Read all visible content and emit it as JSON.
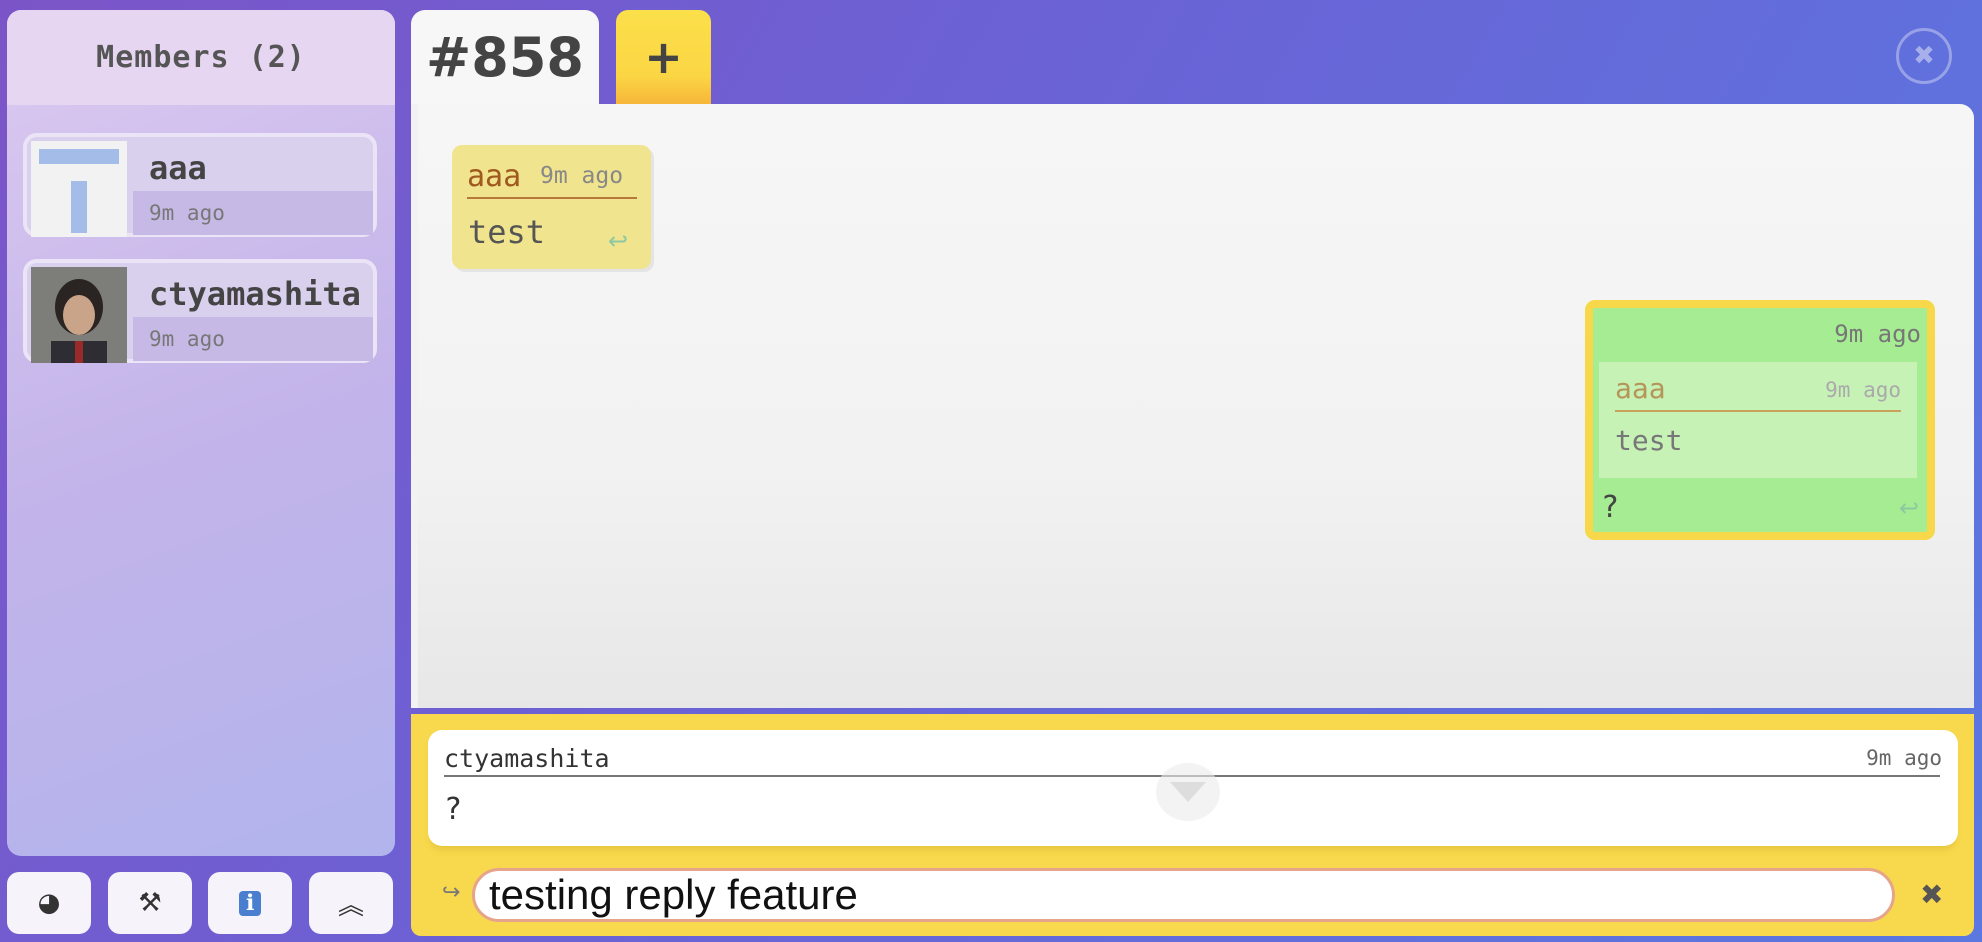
{
  "sidebar": {
    "header": "Members (2)",
    "members": [
      {
        "name": "aaa",
        "last_seen": "9m ago"
      },
      {
        "name": "ctyamashita",
        "last_seen": "9m ago"
      }
    ],
    "tools": [
      {
        "icon": "moon-toggle-icon",
        "glyph": "◕"
      },
      {
        "icon": "tools-icon",
        "glyph": "⚒"
      },
      {
        "icon": "info-icon",
        "glyph": "ℹ"
      },
      {
        "icon": "collapse-icon",
        "glyph": "︽"
      }
    ]
  },
  "tabs": {
    "room": "#858",
    "add": "+"
  },
  "window": {
    "close_glyph": "✖"
  },
  "messages": [
    {
      "author": "aaa",
      "time": "9m ago",
      "text": "test"
    },
    {
      "time": "9m ago",
      "quote": {
        "author": "aaa",
        "time": "9m ago",
        "text": "test"
      },
      "text": "?"
    }
  ],
  "reply_preview": {
    "name": "ctyamashita",
    "time": "9m ago",
    "text": "?"
  },
  "composer": {
    "reply_glyph": "↪",
    "value": "testing reply feature",
    "cancel_glyph": "✖",
    "reply_icon_glyph": "↩"
  },
  "colors": {
    "accent_yellow": "#f8d84c",
    "own_message": "#a6ec92",
    "other_message": "#f0e48e"
  }
}
